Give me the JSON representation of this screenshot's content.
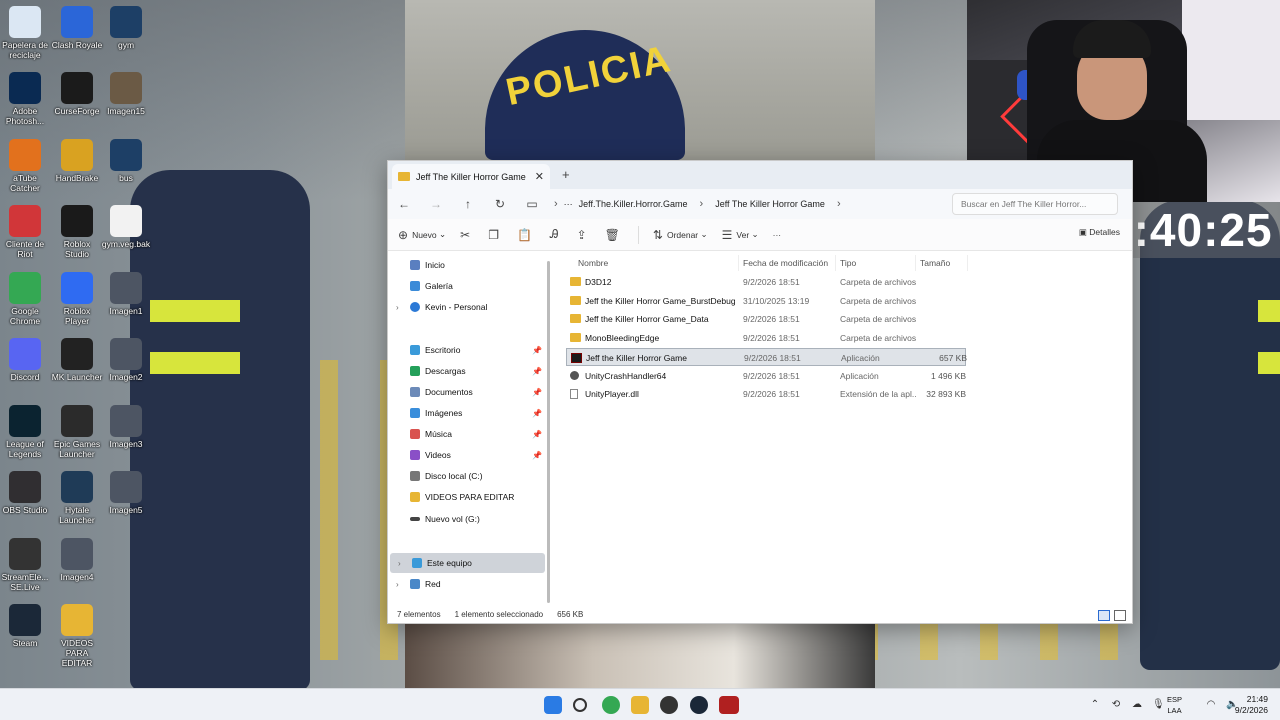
{
  "desktop": {
    "icons": [
      {
        "label": "Papelera de reciclaje",
        "icon": "recycle-bin-icon",
        "color": "#dbe7f3"
      },
      {
        "label": "Clash Royale",
        "icon": "clash-royale-icon",
        "color": "#2b66d8"
      },
      {
        "label": "gym",
        "icon": "vegas-v-icon",
        "color": "#1d3f66"
      },
      {
        "label": "Adobe Photosh...",
        "icon": "photoshop-icon",
        "color": "#0a2a52"
      },
      {
        "label": "CurseForge",
        "icon": "curseforge-icon",
        "color": "#1b1b1b"
      },
      {
        "label": "Imagen15",
        "icon": "image-thumb-icon",
        "color": "#6b5a45"
      },
      {
        "label": "aTube Catcher",
        "icon": "atube-icon",
        "color": "#e2711d"
      },
      {
        "label": "HandBrake",
        "icon": "handbrake-icon",
        "color": "#d9a221"
      },
      {
        "label": "bus",
        "icon": "vegas-v-icon",
        "color": "#1d3f66"
      },
      {
        "label": "Cliente de Riot",
        "icon": "riot-icon",
        "color": "#d13639"
      },
      {
        "label": "Roblox Studio",
        "icon": "roblox-studio-icon",
        "color": "#1a1a1a"
      },
      {
        "label": "gym.veg.bak",
        "icon": "file-icon",
        "color": "#f2f2f2"
      },
      {
        "label": "Google Chrome",
        "icon": "chrome-icon",
        "color": "#34a853"
      },
      {
        "label": "Roblox Player",
        "icon": "roblox-icon",
        "color": "#2f6bf2"
      },
      {
        "label": "Imagen1",
        "icon": "image-thumb-icon",
        "color": "#4d5563"
      },
      {
        "label": "Discord",
        "icon": "discord-icon",
        "color": "#5865f2"
      },
      {
        "label": "MK Launcher",
        "icon": "mk-icon",
        "color": "#222"
      },
      {
        "label": "Imagen2",
        "icon": "image-thumb-icon",
        "color": "#4d5563"
      },
      {
        "label": "League of Legends",
        "icon": "lol-icon",
        "color": "#0b2330"
      },
      {
        "label": "Epic Games Launcher",
        "icon": "epic-icon",
        "color": "#2b2b2b"
      },
      {
        "label": "Imagen3",
        "icon": "image-thumb-icon",
        "color": "#4d5563"
      },
      {
        "label": "OBS Studio",
        "icon": "obs-icon",
        "color": "#302e31"
      },
      {
        "label": "Hytale Launcher",
        "icon": "hytale-icon",
        "color": "#1f3b57"
      },
      {
        "label": "Imagen5",
        "icon": "image-thumb-icon",
        "color": "#4d5563"
      },
      {
        "label": "StreamEle... SE.Live",
        "icon": "streamelements-icon",
        "color": "#333"
      },
      {
        "label": "Imagen4",
        "icon": "image-thumb-icon",
        "color": "#4d5563"
      },
      {
        "label": "Steam",
        "icon": "steam-icon",
        "color": "#1b2838"
      },
      {
        "label": "VIDEOS PARA EDITAR",
        "icon": "folder-icon",
        "color": "#e7b534"
      }
    ],
    "stream_clock": "05:40:25",
    "photo_caption": "POLICIA"
  },
  "explorer": {
    "tab_title": "Jeff The Killer Horror Game",
    "breadcrumb": [
      "Jeff.The.Killer.Horror.Game",
      "Jeff The Killer Horror Game"
    ],
    "search_placeholder": "Buscar en Jeff The Killer Horror...",
    "toolbar": {
      "new_label": "Nuevo",
      "sort_label": "Ordenar",
      "view_label": "Ver",
      "more_label": "···",
      "details_label": "Detalles"
    },
    "nav": {
      "inicio": "Inicio",
      "galeria": "Galería",
      "personal": "Kevin - Personal",
      "escritorio": "Escritorio",
      "descargas": "Descargas",
      "documentos": "Documentos",
      "imagenes": "Imágenes",
      "musica": "Música",
      "videos": "Videos",
      "disco_local": "Disco local (C:)",
      "videos_editar": "VIDEOS PARA EDITAR",
      "nuevo_vol": "Nuevo vol (G:)",
      "este_equipo": "Este equipo",
      "red": "Red"
    },
    "columns": {
      "name": "Nombre",
      "date": "Fecha de modificación",
      "type": "Tipo",
      "size": "Tamaño"
    },
    "files": [
      {
        "name": "D3D12",
        "date": "9/2/2026 18:51",
        "type": "Carpeta de archivos",
        "size": ""
      },
      {
        "name": "Jeff the Killer Horror Game_BurstDebugIn...",
        "date": "31/10/2025 13:19",
        "type": "Carpeta de archivos",
        "size": ""
      },
      {
        "name": "Jeff the Killer Horror Game_Data",
        "date": "9/2/2026 18:51",
        "type": "Carpeta de archivos",
        "size": ""
      },
      {
        "name": "MonoBleedingEdge",
        "date": "9/2/2026 18:51",
        "type": "Carpeta de archivos",
        "size": ""
      },
      {
        "name": "Jeff the Killer Horror Game",
        "date": "9/2/2026 18:51",
        "type": "Aplicación",
        "size": "657 KB"
      },
      {
        "name": "UnityCrashHandler64",
        "date": "9/2/2026 18:51",
        "type": "Aplicación",
        "size": "1 496 KB"
      },
      {
        "name": "UnityPlayer.dll",
        "date": "9/2/2026 18:51",
        "type": "Extensión de la apl...",
        "size": "32 893 KB"
      }
    ],
    "status": {
      "count": "7 elementos",
      "selection": "1 elemento seleccionado",
      "sel_size": "656 KB"
    }
  },
  "taskbar": {
    "lang_top": "ESP",
    "lang_bottom": "LAA",
    "time": "21:49",
    "date": "9/2/2026"
  }
}
